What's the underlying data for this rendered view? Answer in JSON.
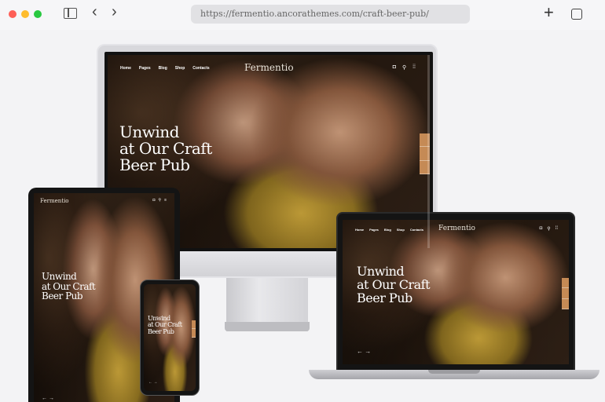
{
  "browser": {
    "url": "https://fermentio.ancorathemes.com/craft-beer-pub/"
  },
  "site": {
    "logo": "Fermentio",
    "nav": [
      "Home",
      "Pages",
      "Blog",
      "Shop",
      "Contacts"
    ],
    "hero_title_lines": [
      "Unwind",
      "at Our Craft",
      "Beer Pub"
    ],
    "slider_arrows": "← →"
  },
  "theme": {
    "accent": "#c58a55",
    "chrome_bg": "#f6f6f8",
    "url_bar_bg": "#e1e1e4"
  }
}
